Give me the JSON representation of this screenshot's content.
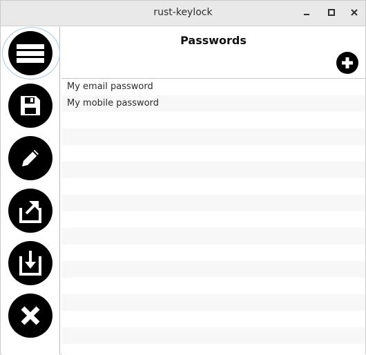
{
  "window": {
    "title": "rust-keylock",
    "controls": [
      "minimize-icon",
      "maximize-icon",
      "close-icon"
    ]
  },
  "sidebar": {
    "buttons": [
      {
        "name": "menu",
        "icon": "hamburger-menu-icon"
      },
      {
        "name": "save",
        "icon": "floppy-disk-icon"
      },
      {
        "name": "edit",
        "icon": "pencil-icon"
      },
      {
        "name": "export",
        "icon": "upload-icon"
      },
      {
        "name": "import",
        "icon": "download-icon"
      },
      {
        "name": "exit",
        "icon": "x-icon"
      }
    ]
  },
  "main": {
    "heading": "Passwords",
    "add_icon": "plus-circle-icon",
    "entries": [
      "My email password",
      "My mobile password"
    ]
  },
  "colors": {
    "icon_background": "#000000",
    "stripe": "#f7f7f7",
    "titlebar": "#e9e9e9"
  }
}
